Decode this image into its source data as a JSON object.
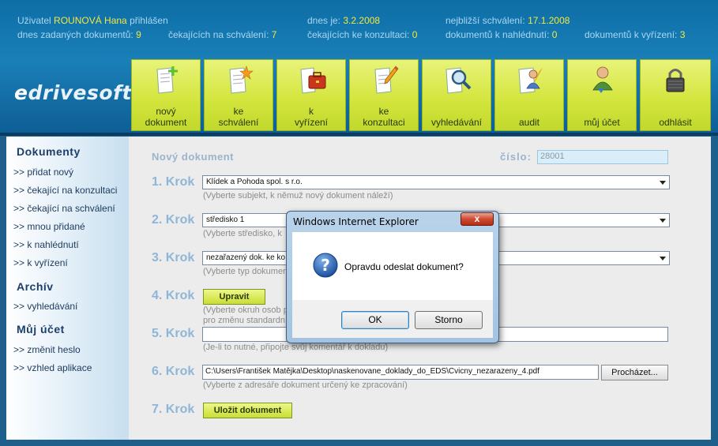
{
  "header": {
    "user_label": "Uživatel",
    "user_name": "ROUNOVÁ Hana",
    "user_suffix": "přihlášen",
    "date_label": "dnes je:",
    "date_value": "3.2.2008",
    "nearest_label": "nejbližší schválení:",
    "nearest_value": "17.1.2008",
    "entered_label": "dnes zadaných dokumentů:",
    "entered_value": "9",
    "waiting_approval_label": "čekajících na schválení:",
    "waiting_approval_value": "7",
    "waiting_consult_label": "čekajících ke konzultaci:",
    "waiting_consult_value": "0",
    "to_view_label": "dokumentů k nahlédnutí:",
    "to_view_value": "0",
    "to_settle_label": "dokumentů k vyřízení:",
    "to_settle_value": "3",
    "logo_a": "e",
    "logo_b": "drivesoft"
  },
  "toolbar": [
    {
      "line1": "nový",
      "line2": "dokument",
      "icon": "new-document-icon"
    },
    {
      "line1": "ke",
      "line2": "schválení",
      "icon": "star-document-icon"
    },
    {
      "line1": "k",
      "line2": "vyřízení",
      "icon": "briefcase-icon"
    },
    {
      "line1": "ke",
      "line2": "konzultaci",
      "icon": "pencil-document-icon"
    },
    {
      "line1": "",
      "line2": "vyhledávání",
      "icon": "magnifier-icon"
    },
    {
      "line1": "",
      "line2": "audit",
      "icon": "audit-icon"
    },
    {
      "line1": "",
      "line2": "můj účet",
      "icon": "user-icon"
    },
    {
      "line1": "",
      "line2": "odhlásit",
      "icon": "lock-icon"
    }
  ],
  "sidebar": {
    "documents_heading": "Dokumenty",
    "documents_items": [
      ">> přidat nový",
      ">> čekající na konzultaci",
      ">> čekající na schválení",
      ">> mnou přidané",
      ">> k nahlédnutí",
      ">> k vyřízení"
    ],
    "archive_heading": "Archív",
    "archive_items": [
      ">> vyhledávání"
    ],
    "account_heading": "Můj účet",
    "account_items": [
      ">> změnit heslo",
      ">> vzhled aplikace"
    ]
  },
  "form": {
    "title": "Nový dokument",
    "number_label": "číslo:",
    "number_value": "28001",
    "steps": [
      {
        "label": "1. Krok",
        "value": "Klídek a Pohoda spol. s r.o.",
        "hint": "(Vyberte subjekt, k němuž nový dokument náleží)"
      },
      {
        "label": "2. Krok",
        "value": "středisko 1",
        "hint": "(Vyberte středisko, k"
      },
      {
        "label": "3. Krok",
        "value": "nezařazený dok. ke ko",
        "hint": "(Vyberte typ dokumen"
      },
      {
        "label": "4. Krok",
        "button": "Upravit",
        "hint1": "(Vyberte okruh osob p",
        "hint2": "pro změnu standardní"
      },
      {
        "label": "5. Krok",
        "value": "",
        "hint": "(Je-li to nutné, připojte svůj komentář k dokladu)"
      },
      {
        "label": "6. Krok",
        "value": "C:\\Users\\František Matějka\\Desktop\\naskenovane_doklady_do_EDS\\Cvicny_nezarazeny_4.pdf",
        "browse": "Procházet...",
        "hint": "(Vyberte z adresáře dokument určený ke zpracování)"
      },
      {
        "label": "7. Krok",
        "button": "Uložit dokument"
      }
    ]
  },
  "dialog": {
    "title": "Windows Internet Explorer",
    "close": "x",
    "message": "Opravdu odeslat dokument?",
    "ok": "OK",
    "cancel": "Storno"
  }
}
